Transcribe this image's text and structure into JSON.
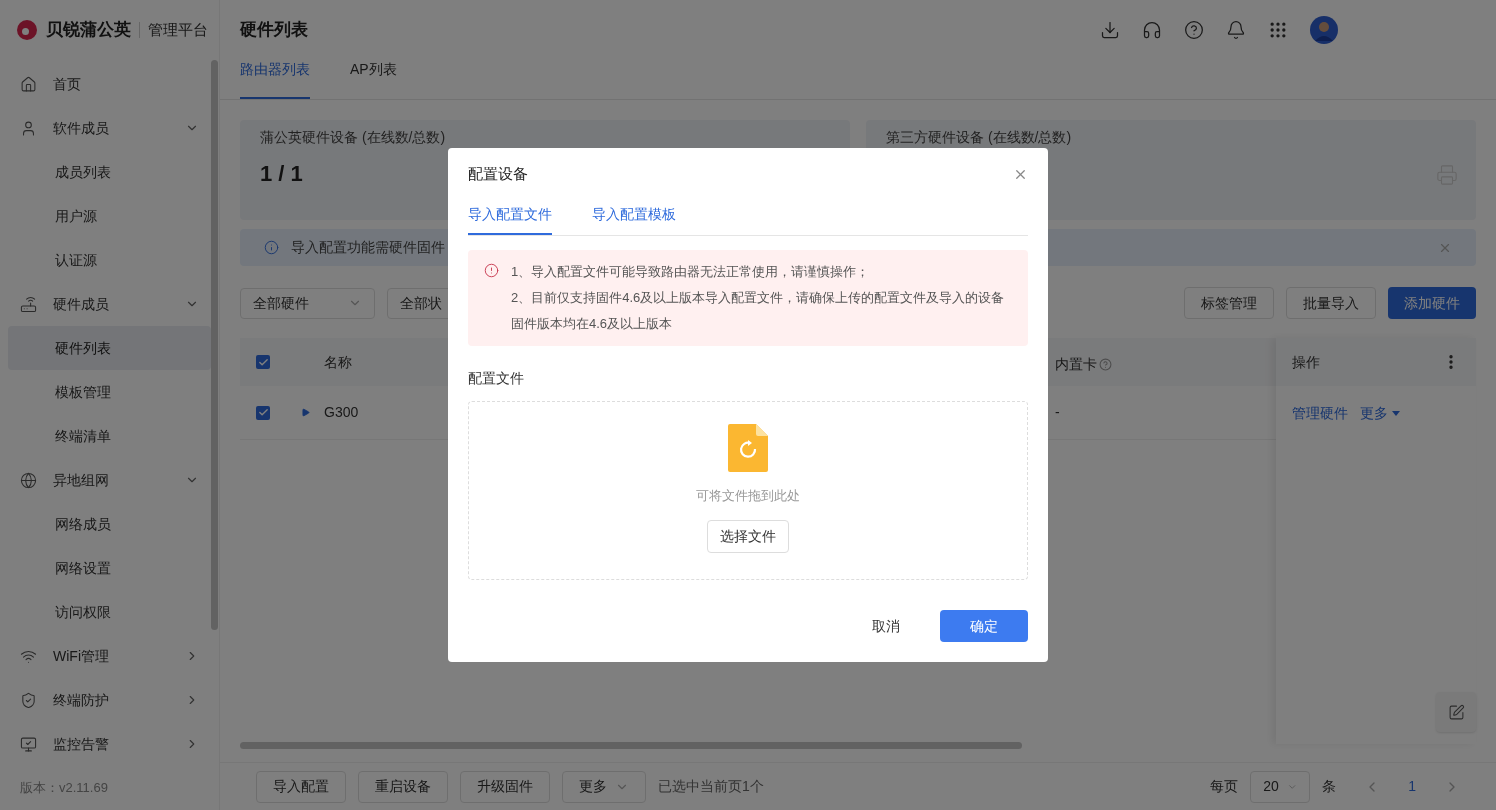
{
  "brand": {
    "name": "贝锐蒲公英",
    "product": "管理平台"
  },
  "sidebar": {
    "items": [
      {
        "label": "首页",
        "selected": false
      },
      {
        "label": "软件成员",
        "selected": false,
        "expanded": true,
        "children": [
          {
            "label": "成员列表",
            "selected": false
          },
          {
            "label": "用户源",
            "selected": false
          },
          {
            "label": "认证源",
            "selected": false
          }
        ]
      },
      {
        "label": "硬件成员",
        "selected": false,
        "expanded": true,
        "children": [
          {
            "label": "硬件列表",
            "selected": true
          },
          {
            "label": "模板管理",
            "selected": false
          },
          {
            "label": "终端清单",
            "selected": false
          }
        ]
      },
      {
        "label": "异地组网",
        "selected": false,
        "expanded": true,
        "children": [
          {
            "label": "网络成员",
            "selected": false
          },
          {
            "label": "网络设置",
            "selected": false
          },
          {
            "label": "访问权限",
            "selected": false
          }
        ]
      },
      {
        "label": "WiFi管理",
        "selected": false,
        "expanded": false
      },
      {
        "label": "终端防护",
        "selected": false,
        "expanded": false
      },
      {
        "label": "监控告警",
        "selected": false,
        "expanded": false
      }
    ],
    "version": "版本：v2.11.69"
  },
  "header": {
    "title": "硬件列表"
  },
  "tabs": [
    {
      "label": "路由器列表",
      "selected": true
    },
    {
      "label": "AP列表",
      "selected": false
    }
  ],
  "stat_cards": [
    {
      "title": "蒲公英硬件设备 (在线数/总数)",
      "value": "1 / 1"
    },
    {
      "title": "第三方硬件设备 (在线数/总数)"
    }
  ],
  "info_bar": {
    "text": "导入配置功能需硬件固件"
  },
  "filters": [
    {
      "value": "全部硬件"
    },
    {
      "value": "全部状"
    }
  ],
  "toolbar_buttons": [
    {
      "label": "标签管理",
      "primary": false
    },
    {
      "label": "批量导入",
      "primary": false
    },
    {
      "label": "添加硬件",
      "primary": true
    }
  ],
  "table": {
    "header_checked": true,
    "columns": [
      "名称",
      "内置卡",
      "操作"
    ],
    "rows": [
      {
        "checked": true,
        "expanded": false,
        "name": "G300",
        "card": "-",
        "actions": [
          "管理硬件",
          "更多"
        ]
      }
    ]
  },
  "bottom_bar": {
    "buttons": [
      {
        "label": "导入配置",
        "kind": "button"
      },
      {
        "label": "重启设备",
        "kind": "button"
      },
      {
        "label": "升级固件",
        "kind": "button"
      },
      {
        "label": "更多",
        "kind": "dropdown"
      }
    ],
    "selection_text": "已选中当前页1个",
    "per_page_label": "每页",
    "per_page": "20",
    "per_page_unit": "条",
    "pages": [
      {
        "label": "1",
        "selected": true
      }
    ]
  },
  "dialog": {
    "title": "配置设备",
    "tabs": [
      {
        "label": "导入配置文件",
        "selected": true
      },
      {
        "label": "导入配置模板",
        "selected": false
      }
    ],
    "alert": [
      "1、导入配置文件可能导致路由器无法正常使用，请谨慎操作；",
      "2、目前仅支持固件4.6及以上版本导入配置文件，请确保上传的配置文件及导入的设备固件版本均在4.6及以上版本"
    ],
    "field_label": "配置文件",
    "drop_hint": "可将文件拖到此处",
    "choose_button": "选择文件",
    "cancel": "取消",
    "confirm": "确定"
  }
}
